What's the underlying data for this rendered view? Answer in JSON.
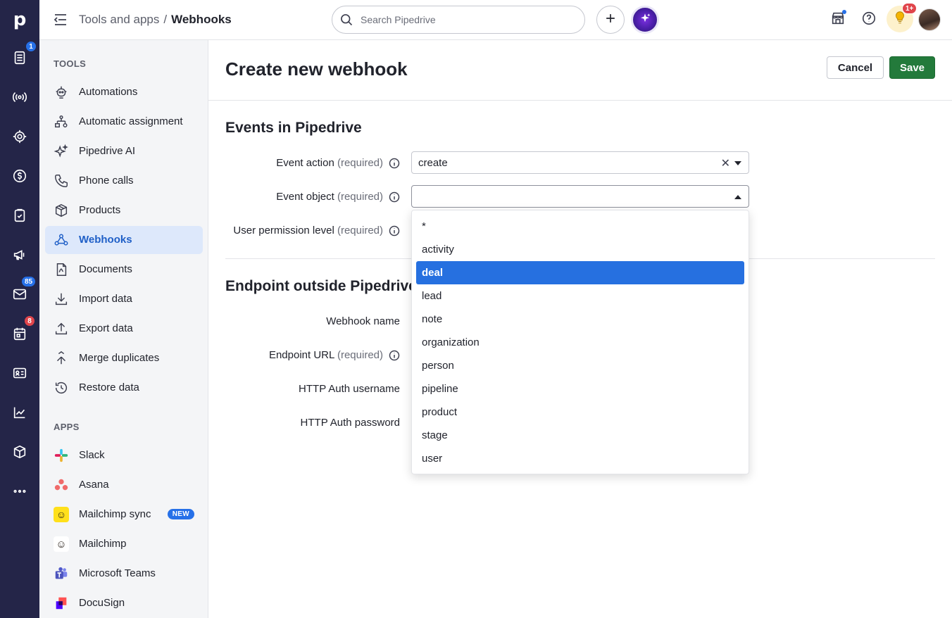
{
  "rail": {
    "logo": "p",
    "items": [
      {
        "icon": "deals-list-icon",
        "badge": "1"
      },
      {
        "icon": "leads-broadcast-icon",
        "badge": ""
      },
      {
        "icon": "target-icon",
        "badge": ""
      },
      {
        "icon": "dollar-icon",
        "badge": ""
      },
      {
        "icon": "clipboard-check-icon",
        "badge": ""
      },
      {
        "icon": "megaphone-icon",
        "badge": ""
      },
      {
        "icon": "mail-icon",
        "badge": "85"
      },
      {
        "icon": "calendar-icon",
        "badge": "8"
      },
      {
        "icon": "contacts-card-icon",
        "badge": ""
      },
      {
        "icon": "chart-icon",
        "badge": ""
      },
      {
        "icon": "box-icon",
        "badge": ""
      },
      {
        "icon": "more-icon",
        "badge": ""
      }
    ]
  },
  "topbar": {
    "breadcrumb_parent": "Tools and apps",
    "breadcrumb_sep": "/",
    "breadcrumb_current": "Webhooks",
    "search_placeholder": "Search Pipedrive",
    "notification_badge": "1+"
  },
  "sidenav": {
    "tools_title": "TOOLS",
    "tools": [
      {
        "label": "Automations",
        "icon": "robot-icon"
      },
      {
        "label": "Automatic assignment",
        "icon": "assignment-icon"
      },
      {
        "label": "Pipedrive AI",
        "icon": "sparkle-icon"
      },
      {
        "label": "Phone calls",
        "icon": "phone-icon"
      },
      {
        "label": "Products",
        "icon": "box-icon"
      },
      {
        "label": "Webhooks",
        "icon": "webhook-icon",
        "active": true
      },
      {
        "label": "Documents",
        "icon": "document-icon"
      },
      {
        "label": "Import data",
        "icon": "download-icon"
      },
      {
        "label": "Export data",
        "icon": "upload-icon"
      },
      {
        "label": "Merge duplicates",
        "icon": "merge-icon"
      },
      {
        "label": "Restore data",
        "icon": "restore-icon"
      }
    ],
    "apps_title": "APPS",
    "apps": [
      {
        "label": "Slack",
        "icon": "slack-icon"
      },
      {
        "label": "Asana",
        "icon": "asana-icon"
      },
      {
        "label": "Mailchimp sync",
        "icon": "mailchimp-icon",
        "badge": "NEW"
      },
      {
        "label": "Mailchimp",
        "icon": "mailchimp-icon"
      },
      {
        "label": "Microsoft Teams",
        "icon": "teams-icon"
      },
      {
        "label": "DocuSign",
        "icon": "docusign-icon"
      }
    ]
  },
  "main": {
    "title": "Create new webhook",
    "cancel_label": "Cancel",
    "save_label": "Save",
    "events_heading": "Events in Pipedrive",
    "event_action_label": "Event action",
    "event_action_value": "create",
    "event_object_label": "Event object",
    "permission_label": "User permission level",
    "required_text": "(required)",
    "endpoint_heading": "Endpoint outside Pipedrive",
    "webhook_name_label": "Webhook name",
    "endpoint_url_label": "Endpoint URL",
    "http_user_label": "HTTP Auth username",
    "http_pass_label": "HTTP Auth password",
    "event_object_options": [
      "*",
      "activity",
      "deal",
      "lead",
      "note",
      "organization",
      "person",
      "pipeline",
      "product",
      "stage",
      "user"
    ],
    "highlighted_option": "deal"
  },
  "colors": {
    "rail_bg": "#242548",
    "accent_blue": "#2670e0",
    "save_green": "#237a3b",
    "active_nav_bg": "#dde8fb"
  }
}
